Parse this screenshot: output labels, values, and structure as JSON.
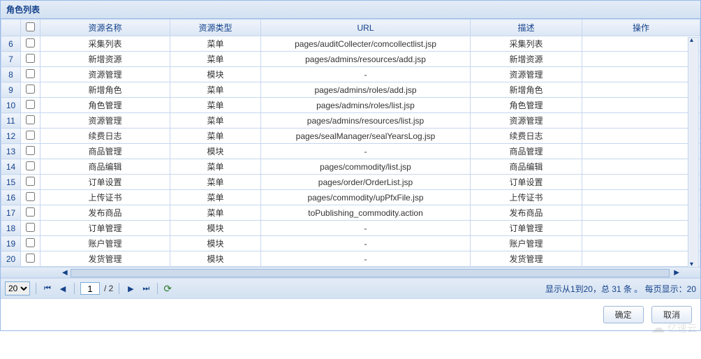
{
  "panel": {
    "title": "角色列表"
  },
  "columns": {
    "name": "资源名称",
    "type": "资源类型",
    "url": "URL",
    "desc": "描述",
    "op": "操作"
  },
  "rows": [
    {
      "num": "6",
      "name": "采集列表",
      "type": "菜单",
      "url": "pages/auditCollecter/comcollectlist.jsp",
      "desc": "采集列表"
    },
    {
      "num": "7",
      "name": "新增资源",
      "type": "菜单",
      "url": "pages/admins/resources/add.jsp",
      "desc": "新增资源"
    },
    {
      "num": "8",
      "name": "资源管理",
      "type": "模块",
      "url": "-",
      "desc": "资源管理"
    },
    {
      "num": "9",
      "name": "新增角色",
      "type": "菜单",
      "url": "pages/admins/roles/add.jsp",
      "desc": "新增角色"
    },
    {
      "num": "10",
      "name": "角色管理",
      "type": "菜单",
      "url": "pages/admins/roles/list.jsp",
      "desc": "角色管理"
    },
    {
      "num": "11",
      "name": "资源管理",
      "type": "菜单",
      "url": "pages/admins/resources/list.jsp",
      "desc": "资源管理"
    },
    {
      "num": "12",
      "name": "续费日志",
      "type": "菜单",
      "url": "pages/sealManager/sealYearsLog.jsp",
      "desc": "续费日志"
    },
    {
      "num": "13",
      "name": "商品管理",
      "type": "模块",
      "url": "-",
      "desc": "商品管理"
    },
    {
      "num": "14",
      "name": "商品编辑",
      "type": "菜单",
      "url": "pages/commodity/list.jsp",
      "desc": "商品编辑"
    },
    {
      "num": "15",
      "name": "订单设置",
      "type": "菜单",
      "url": "pages/order/OrderList.jsp",
      "desc": "订单设置"
    },
    {
      "num": "16",
      "name": "上传证书",
      "type": "菜单",
      "url": "pages/commodity/upPfxFile.jsp",
      "desc": "上传证书"
    },
    {
      "num": "17",
      "name": "发布商品",
      "type": "菜单",
      "url": "toPublishing_commodity.action",
      "desc": "发布商品"
    },
    {
      "num": "18",
      "name": "订单管理",
      "type": "模块",
      "url": "-",
      "desc": "订单管理"
    },
    {
      "num": "19",
      "name": "账户管理",
      "type": "模块",
      "url": "-",
      "desc": "账户管理"
    },
    {
      "num": "20",
      "name": "发货管理",
      "type": "模块",
      "url": "-",
      "desc": "发货管理"
    }
  ],
  "pager": {
    "pageSize": "20",
    "page": "1",
    "totalPagesLabel": "/ 2",
    "info": "显示从1到20，总 31 条 。 每页显示：20"
  },
  "buttons": {
    "ok": "确定",
    "cancel": "取消"
  },
  "watermark": "亿速云"
}
